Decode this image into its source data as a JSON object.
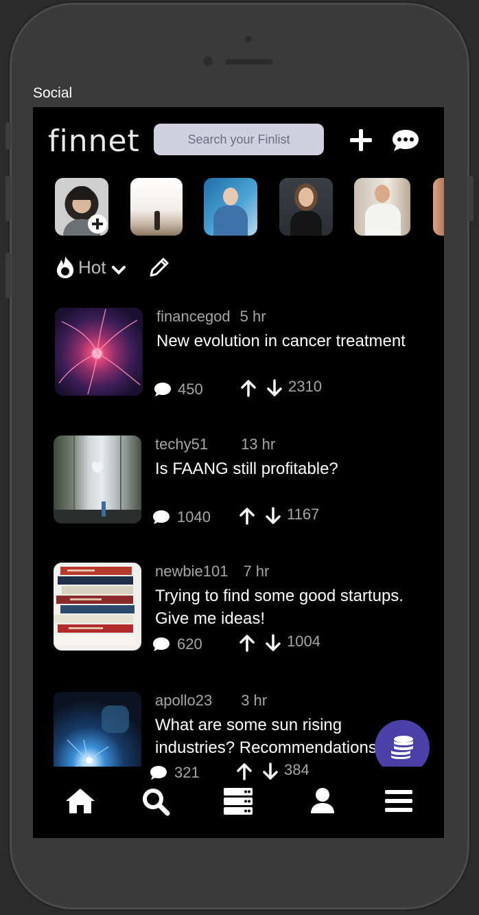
{
  "device_label": "Social",
  "app": {
    "logo": "finnet",
    "search_placeholder": "Search your Finlist"
  },
  "header_icons": [
    "plus-icon",
    "chat-bubble-icon"
  ],
  "stories": [
    {
      "name": "my-story",
      "has_add_badge": true
    },
    {
      "name": "story-2"
    },
    {
      "name": "story-3"
    },
    {
      "name": "story-4"
    },
    {
      "name": "story-5"
    },
    {
      "name": "story-6"
    }
  ],
  "sort": {
    "label": "Hot",
    "icon": "flame-icon"
  },
  "posts": [
    {
      "author": "financegod",
      "time": "5 hr",
      "title": "New evolution in cancer treatment",
      "comments": "450",
      "votes": "2310"
    },
    {
      "author": "techy51",
      "time": "13 hr",
      "title": "Is FAANG still profitable?",
      "comments": "1040",
      "votes": "1167"
    },
    {
      "author": "newbie101",
      "time": "7 hr",
      "title": "Trying to find some good startups. Give me ideas!",
      "comments": "620",
      "votes": "1004"
    },
    {
      "author": "apollo23",
      "time": "3 hr",
      "title": "What are some sun rising industries? Recommendations?",
      "comments": "321",
      "votes": "384"
    }
  ],
  "nav": [
    "home-icon",
    "search-icon",
    "server-icon",
    "user-icon",
    "menu-icon"
  ],
  "colors": {
    "fab": "#4b3fa8",
    "search_bg": "#d0d0df"
  }
}
